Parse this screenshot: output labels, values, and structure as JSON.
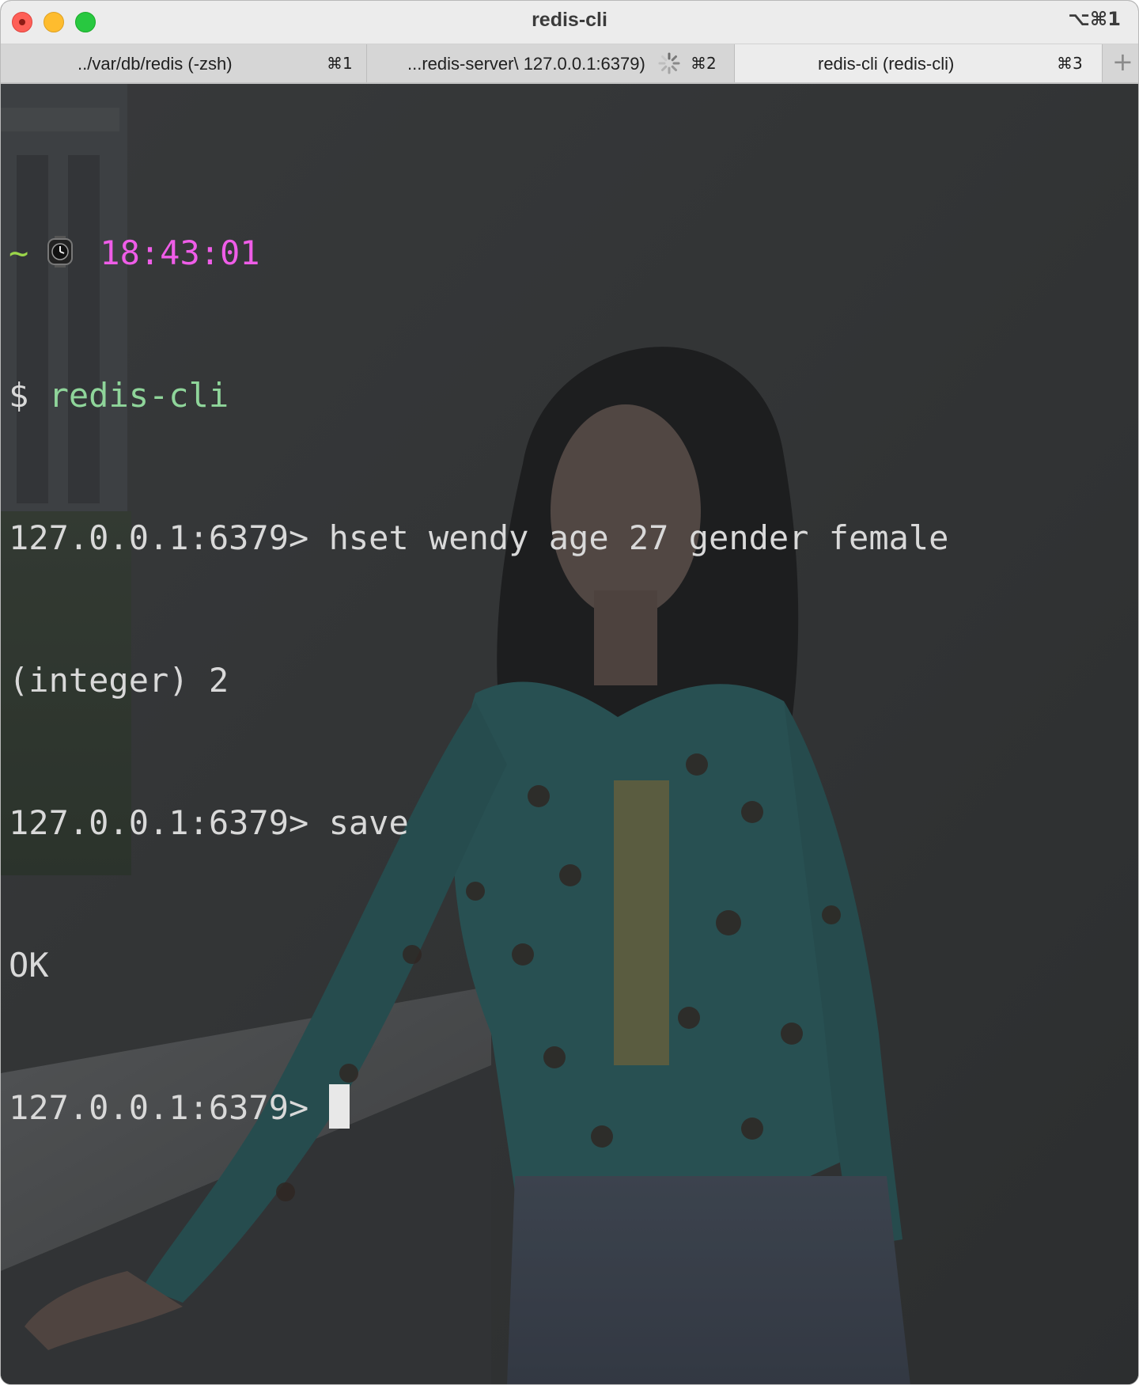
{
  "window": {
    "title": "redis-cli",
    "shortcut": "⌥⌘1"
  },
  "tabs": [
    {
      "label": "../var/db/redis (-zsh)",
      "shortcut": "⌘1",
      "active": false
    },
    {
      "label": "...redis-server\\ 127.0.0.1:6379)",
      "shortcut": "⌘2",
      "active": false,
      "busy": true
    },
    {
      "label": "redis-cli (redis-cli)",
      "shortcut": "⌘3",
      "active": true
    }
  ],
  "new_tab_glyph": "+",
  "terminal": {
    "prompt_tilde": "~",
    "prompt_icon": "watch-icon",
    "prompt_time": "18:43:01",
    "dollar": "$",
    "command": "redis-cli",
    "lines": [
      {
        "prompt": "127.0.0.1:6379>",
        "input": "hset wendy age 27 gender female"
      },
      {
        "output": "(integer) 2"
      },
      {
        "prompt": "127.0.0.1:6379>",
        "input": "save"
      },
      {
        "output": "OK"
      },
      {
        "prompt": "127.0.0.1:6379>",
        "input": ""
      }
    ]
  },
  "colors": {
    "tilde": "#9bd64a",
    "time": "#ef5de8",
    "command": "#8fd59a",
    "text": "#d9d9d9",
    "close": "#fe5f57",
    "minimize": "#febc2e",
    "zoom": "#28c840"
  }
}
